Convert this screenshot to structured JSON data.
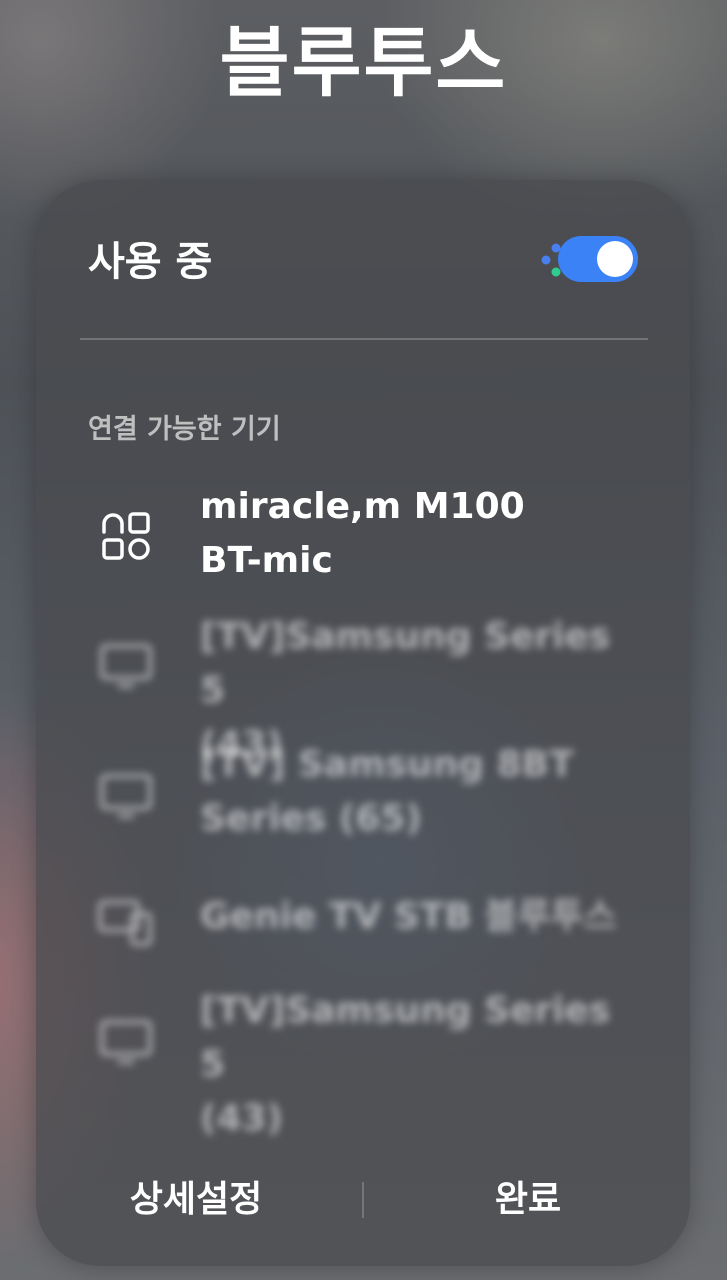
{
  "page_title": "블루투스",
  "header": {
    "status_label": "사용 중",
    "scan_icon": "dots-scan-icon",
    "toggle_on": true,
    "accent_color": "#3b82f6"
  },
  "section_label": "연결 가능한 기기",
  "devices": [
    {
      "name_line1": "miracle,m M100",
      "name_line2": "BT-mic",
      "icon": "accessory-icon"
    },
    {
      "name_line1": "[TV]Samsung Series 5",
      "name_line2": "(43)",
      "icon": "tv-icon"
    },
    {
      "name_line1": "[TV] Samsung 8BT",
      "name_line2": "Series (65)",
      "icon": "tv-icon"
    },
    {
      "name_line1": "Genie TV STB 블루투스",
      "name_line2": "",
      "icon": "set-top-box-icon"
    },
    {
      "name_line1": "[TV]Samsung Series 5",
      "name_line2": "(43)",
      "icon": "tv-icon"
    }
  ],
  "footer": {
    "settings_label": "상세설정",
    "done_label": "완료"
  }
}
